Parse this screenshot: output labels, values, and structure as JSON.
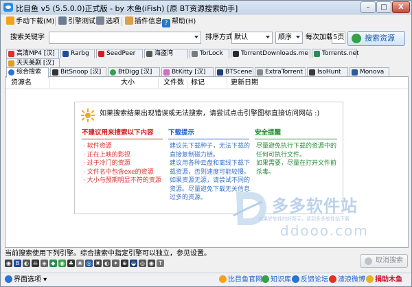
{
  "window": {
    "title": "比目鱼 v5 (5.5.0.0)正式版 - by 木鱼(iFish) [原 BT资源搜索助手]",
    "minimize_glyph": "–",
    "maximize_glyph": "□",
    "close_glyph": "X"
  },
  "menu": {
    "manual_download": "手动下载(M)",
    "engine_test": "引擎测试",
    "options": "选项",
    "plugin_info": "插件信息",
    "help": "帮助(H)"
  },
  "search": {
    "keyword_label": "搜索关键字",
    "keyword_value": "",
    "sort_label": "排序方式",
    "sort_value": "默认",
    "order_value": "顺序",
    "per_load_label": "每次加载",
    "per_load_value": "5页",
    "search_button": "搜索资源"
  },
  "site_tabs_row1": [
    {
      "label": "高清MP4 [汉]",
      "color": "#d8332f"
    },
    {
      "label": "Rarbg",
      "color": "#1f4b9a"
    },
    {
      "label": "SeedPeer",
      "color": "#d21f1f"
    },
    {
      "label": "海盗湾",
      "color": "#555555"
    },
    {
      "label": "TorLock",
      "color": "#7a7a7a"
    },
    {
      "label": "TorrentDownloads.me",
      "color": "#2b2b2b"
    },
    {
      "label": "Torrents.net",
      "color": "#2e8b57"
    },
    {
      "label": "天天美剧 [汉]",
      "color": "#e0a020"
    }
  ],
  "site_tabs_row2": [
    {
      "label": "综合搜索",
      "color": "#2b74d1"
    },
    {
      "label": "BitSnoop [汉]",
      "color": "#333333"
    },
    {
      "label": "BtDigg [汉]",
      "color": "#35a048"
    },
    {
      "label": "BtKitty [汉]",
      "color": "#d070c0"
    },
    {
      "label": "BTScene",
      "color": "#1c3f7a"
    },
    {
      "label": "ExtraTorrent",
      "color": "#8a8a8a"
    },
    {
      "label": "IsoHunt",
      "color": "#3a3a3a"
    },
    {
      "label": "Monova",
      "color": "#2b5aa0"
    }
  ],
  "results": {
    "columns": [
      "资源名",
      "大小",
      "文件数",
      "标记",
      "更新日期"
    ]
  },
  "notice": {
    "headline": "如果搜索结果出现错误或无法搜索，请尝试点击引擎图标直接访问网站 :)",
    "not_recommended_title": "不建议用来搜索以下内容",
    "not_recommended_items": [
      "· 软件资源",
      "· 正在上映的影视",
      "· 过于冷门的资源",
      "· 文件名中包含exe的资源",
      "· 大小与预期明显不符的资源"
    ],
    "tips_title": "下载提示",
    "tips_text": [
      "建议先下载种子，无法下载的直接复制磁力链。",
      "建议用各种云盘和离线下载下载资源，否则速度可能较慢。",
      "如果资源无源，请尝试不同的资源。尽量避免下载无关信息过多的资源。"
    ],
    "safety_title": "安全提醒",
    "safety_text": [
      "尽量避免执行下载的资源中的任何可执行文件。",
      "如果需要，尽量在打开文件前杀毒。"
    ]
  },
  "watermark": {
    "brand": "多多软件站",
    "slogan": "如果好软件的好帮手，请到多多软件站下载",
    "url": "ddooo.com"
  },
  "status": {
    "text": "当前搜索使用下列引擎。综合搜索中指定引擎可以独立，参见设置。",
    "cancel_button": "取消搜索",
    "engine_glyphs": [
      "◉",
      "B",
      "◐",
      "☠",
      "◈",
      "◆",
      "◉",
      "♣",
      "❀",
      "◎",
      "✖",
      "◐",
      "✦",
      "⊕",
      "◒",
      "◎",
      "◉",
      "T"
    ]
  },
  "bottom": {
    "interface_options": "界面选项",
    "official_site": "比目鱼官网",
    "knowledge": "知识库",
    "feedback": "反馈论坛",
    "weibo": "渣浪微博",
    "donate": "捐助木鱼"
  },
  "colors": {
    "donate": "#c8102e",
    "link": "#1c5fd1"
  }
}
